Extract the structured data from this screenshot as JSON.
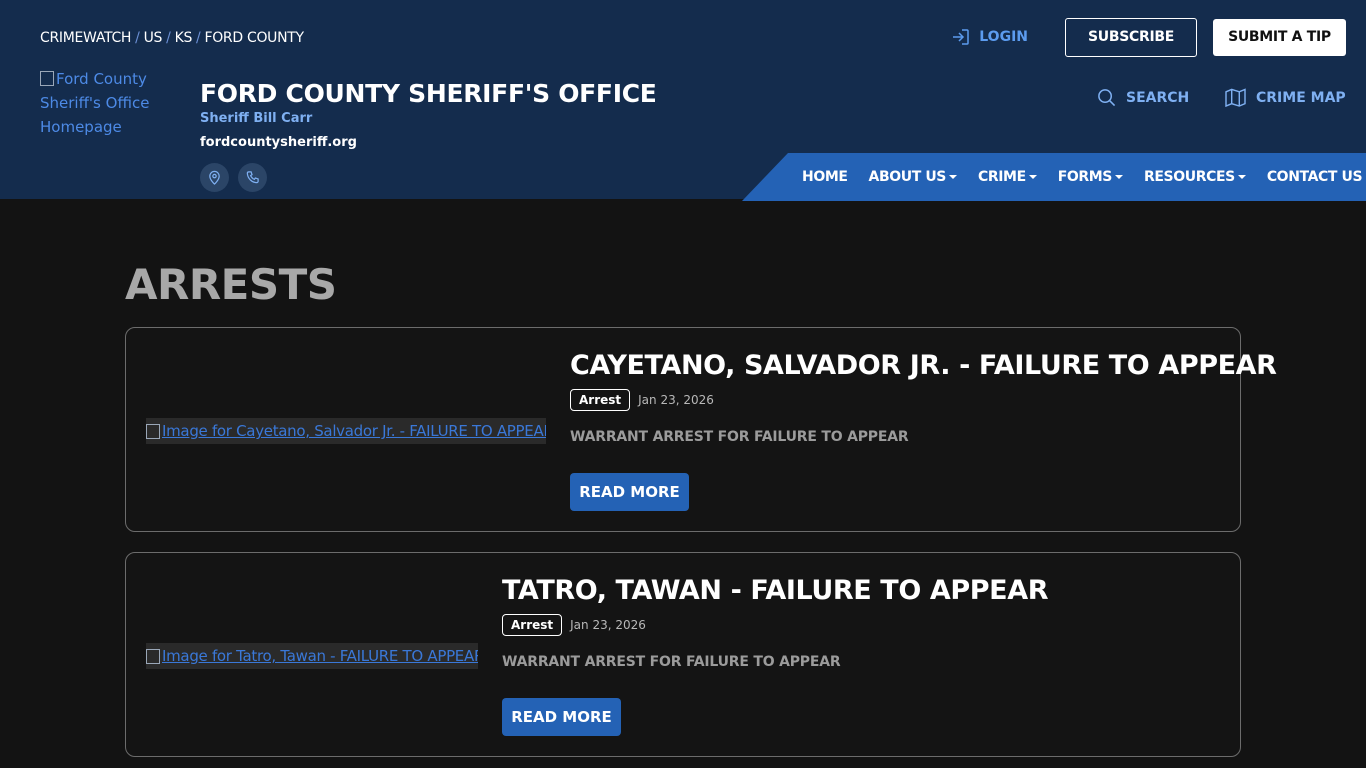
{
  "breadcrumb": [
    {
      "label": "CRIMEWATCH"
    },
    {
      "label": "US"
    },
    {
      "label": "KS"
    },
    {
      "label": "FORD COUNTY"
    }
  ],
  "breadcrumb_separator": "/",
  "top_actions": {
    "login_label": "LOGIN",
    "subscribe_label": "SUBSCRIBE",
    "tip_label": "SUBMIT A TIP"
  },
  "logo": {
    "alt_text": "Ford County Sheriff's Office Homepage"
  },
  "site": {
    "title": "FORD COUNTY SHERIFF'S OFFICE",
    "sheriff": "Sheriff Bill Carr",
    "url": "fordcountysheriff.org"
  },
  "utility": {
    "search_label": "SEARCH",
    "crime_map_label": "CRIME MAP"
  },
  "nav": {
    "items": [
      {
        "label": "HOME",
        "dropdown": false
      },
      {
        "label": "ABOUT US",
        "dropdown": true
      },
      {
        "label": "CRIME",
        "dropdown": true
      },
      {
        "label": "FORMS",
        "dropdown": true
      },
      {
        "label": "RESOURCES",
        "dropdown": true
      },
      {
        "label": "CONTACT US",
        "dropdown": false
      }
    ]
  },
  "page": {
    "title": "ARRESTS"
  },
  "arrests": [
    {
      "image_alt": "Image for Cayetano, Salvador Jr. - FAILURE TO APPEAR",
      "title": "CAYETANO, SALVADOR JR. - FAILURE TO APPEAR",
      "badge": "Arrest",
      "date": "Jan 23, 2026",
      "description": "WARRANT ARREST FOR FAILURE TO APPEAR",
      "button": "READ MORE"
    },
    {
      "image_alt": "Image for Tatro, Tawan - FAILURE TO APPEAR",
      "title": "TATRO, TAWAN - FAILURE TO APPEAR",
      "badge": "Arrest",
      "date": "Jan 23, 2026",
      "description": "WARRANT ARREST FOR FAILURE TO APPEAR",
      "button": "READ MORE"
    }
  ],
  "colors": {
    "header_bg": "#142c4d",
    "nav_bg": "#2462b5",
    "accent_link": "#5c9cf0",
    "page_bg": "#131313"
  },
  "icons": [
    "login-icon",
    "map-pin-icon",
    "phone-icon",
    "search-icon",
    "map-icon",
    "caret-down-icon",
    "broken-image-icon"
  ]
}
